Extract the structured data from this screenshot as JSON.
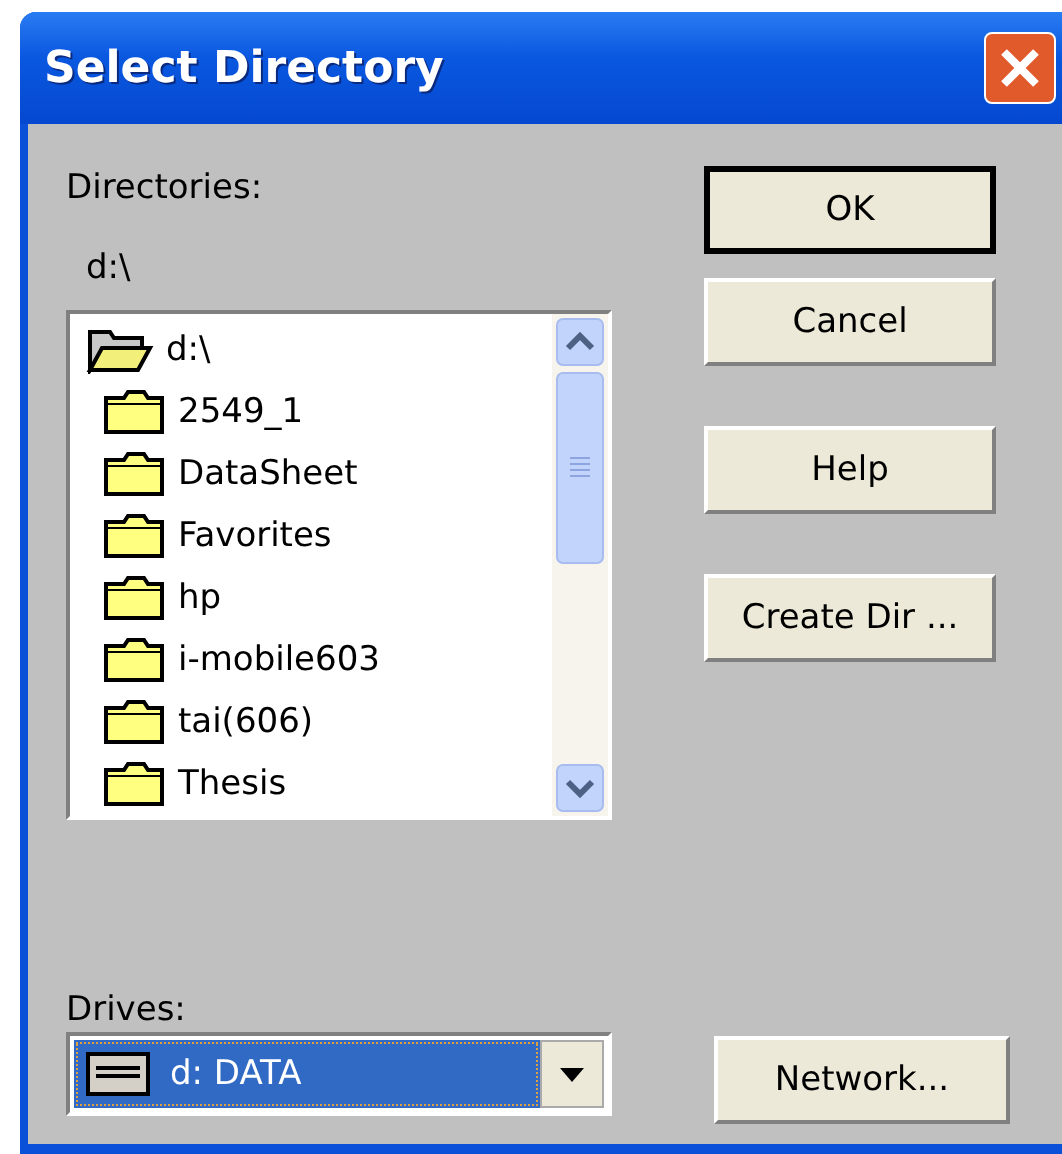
{
  "window": {
    "title": "Select Directory"
  },
  "directories": {
    "label": "Directories:",
    "current_path": "d:\\",
    "tree": [
      {
        "name": "d:\\",
        "expanded": true,
        "children": [
          {
            "name": "2549_1",
            "expanded": false
          },
          {
            "name": "DataSheet",
            "expanded": false
          },
          {
            "name": "Favorites",
            "expanded": false
          },
          {
            "name": "hp",
            "expanded": false
          },
          {
            "name": "i-mobile603",
            "expanded": false
          },
          {
            "name": "tai(606)",
            "expanded": false
          },
          {
            "name": "Thesis",
            "expanded": false
          }
        ]
      }
    ]
  },
  "drives": {
    "label": "Drives:",
    "value": "d: DATA"
  },
  "buttons": [
    {
      "label": "OK",
      "default": true
    },
    {
      "label": "Cancel",
      "default": false
    },
    {
      "label": "Help",
      "default": false
    },
    {
      "label": "Create Dir ...",
      "default": false
    }
  ],
  "network_button": {
    "label": "Network..."
  }
}
